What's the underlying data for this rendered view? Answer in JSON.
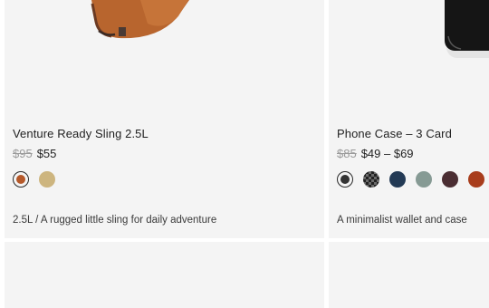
{
  "products": [
    {
      "title": "Venture Ready Sling 2.5L",
      "price_old": "$95",
      "price_new": "$55",
      "description": "2.5L / A rugged little sling for daily adventure",
      "swatches": [
        {
          "color": "#b5592a",
          "selected": true
        },
        {
          "color": "#cdb57f",
          "selected": false
        }
      ]
    },
    {
      "title": "Phone Case – 3 Card",
      "price_old": "$85",
      "price_new": "$49 – $69",
      "description": "A minimalist wallet and case",
      "swatches": [
        {
          "color": "#333333",
          "selected": true
        },
        {
          "color": "#2e2e2e",
          "selected": false,
          "pattern": "check"
        },
        {
          "color": "#233a55",
          "selected": false
        },
        {
          "color": "#869a94",
          "selected": false
        },
        {
          "color": "#4a2d32",
          "selected": false
        },
        {
          "color": "#a83d1c",
          "selected": false
        }
      ]
    }
  ]
}
